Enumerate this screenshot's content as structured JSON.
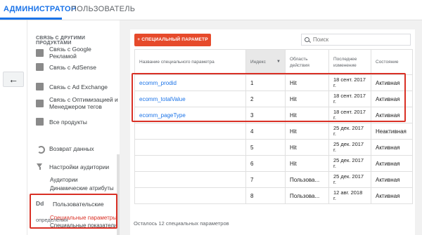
{
  "tabs": {
    "admin": "АДМИНИСТРАТОР",
    "user": "ПОЛЬЗОВАТЕЛЬ"
  },
  "back_button": "←",
  "sidebar": {
    "heading": "СВЯЗЬ С ДРУГИМИ ПРОДУКТАМИ",
    "items": [
      {
        "label": "Связь с Google Рекламой",
        "icon": "google-ads-icon"
      },
      {
        "label": "Связь с AdSense",
        "icon": "adsense-icon"
      },
      {
        "label": "Связь с Ad Exchange",
        "icon": "ad-exchange-icon"
      },
      {
        "label": "Связь с Оптимизацией и Менеджером тегов",
        "icon": "optimize-icon"
      },
      {
        "label": "Все продукты",
        "icon": "all-products-icon"
      },
      {
        "label": "Возврат данных",
        "icon": "data-return-icon"
      },
      {
        "label": "Настройки аудитории",
        "icon": "funnel-icon"
      }
    ],
    "audience_sub": [
      "Аудитории",
      "Динамические атрибуты"
    ],
    "custom_group": {
      "icon_text": "Dd",
      "label": "Пользовательские",
      "label_cont": "определения"
    },
    "custom_sub": [
      "Специальные параметры",
      "Специальные показатели"
    ]
  },
  "toolbar": {
    "add_button": "+ СПЕЦИАЛЬНЫЙ ПАРАМЕТР",
    "search_placeholder": "Поиск"
  },
  "table": {
    "headers": {
      "name": "Название специального параметра",
      "index": "Индекс",
      "scope": "Область действия",
      "updated": "Последнее изменение",
      "state": "Состояние"
    },
    "sort_indicator": "▼",
    "rows": [
      {
        "name": "ecomm_prodid",
        "index": "1",
        "scope": "Hit",
        "updated": "18 сент. 2017 г.",
        "state": "Активная"
      },
      {
        "name": "ecomm_totalValue",
        "index": "2",
        "scope": "Hit",
        "updated": "18 сент. 2017 г.",
        "state": "Активная"
      },
      {
        "name": "ecomm_pageType",
        "index": "3",
        "scope": "Hit",
        "updated": "18 сент. 2017 г.",
        "state": "Активная"
      },
      {
        "name": "",
        "index": "4",
        "scope": "Hit",
        "updated": "25 дек. 2017 г.",
        "state": "Неактивная"
      },
      {
        "name": "",
        "index": "5",
        "scope": "Hit",
        "updated": "25 дек. 2017 г.",
        "state": "Активная"
      },
      {
        "name": "",
        "index": "6",
        "scope": "Hit",
        "updated": "25 дек. 2017 г.",
        "state": "Активная"
      },
      {
        "name": "",
        "index": "7",
        "scope": "Пользова...",
        "updated": "25 дек. 2017 г.",
        "state": "Активная"
      },
      {
        "name": "",
        "index": "8",
        "scope": "Пользова...",
        "updated": "12 авг. 2018 г.",
        "state": "Активная"
      }
    ]
  },
  "footer": "Осталось 12 специальных параметров",
  "colors": {
    "accent": "#1a73e8",
    "add_button": "#e64a2b",
    "highlight": "#d93025"
  }
}
